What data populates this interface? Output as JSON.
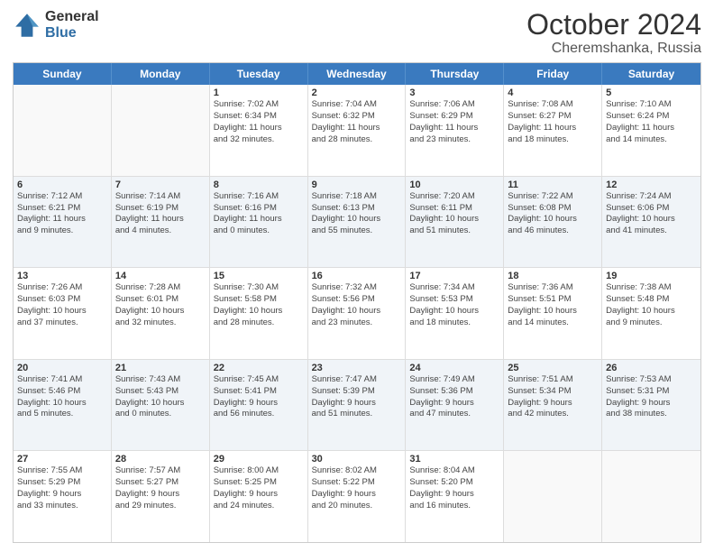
{
  "header": {
    "logo_general": "General",
    "logo_blue": "Blue",
    "month": "October 2024",
    "location": "Cheremshanka, Russia"
  },
  "weekdays": [
    "Sunday",
    "Monday",
    "Tuesday",
    "Wednesday",
    "Thursday",
    "Friday",
    "Saturday"
  ],
  "rows": [
    [
      {
        "day": "",
        "info": ""
      },
      {
        "day": "",
        "info": ""
      },
      {
        "day": "1",
        "info": "Sunrise: 7:02 AM\nSunset: 6:34 PM\nDaylight: 11 hours\nand 32 minutes."
      },
      {
        "day": "2",
        "info": "Sunrise: 7:04 AM\nSunset: 6:32 PM\nDaylight: 11 hours\nand 28 minutes."
      },
      {
        "day": "3",
        "info": "Sunrise: 7:06 AM\nSunset: 6:29 PM\nDaylight: 11 hours\nand 23 minutes."
      },
      {
        "day": "4",
        "info": "Sunrise: 7:08 AM\nSunset: 6:27 PM\nDaylight: 11 hours\nand 18 minutes."
      },
      {
        "day": "5",
        "info": "Sunrise: 7:10 AM\nSunset: 6:24 PM\nDaylight: 11 hours\nand 14 minutes."
      }
    ],
    [
      {
        "day": "6",
        "info": "Sunrise: 7:12 AM\nSunset: 6:21 PM\nDaylight: 11 hours\nand 9 minutes."
      },
      {
        "day": "7",
        "info": "Sunrise: 7:14 AM\nSunset: 6:19 PM\nDaylight: 11 hours\nand 4 minutes."
      },
      {
        "day": "8",
        "info": "Sunrise: 7:16 AM\nSunset: 6:16 PM\nDaylight: 11 hours\nand 0 minutes."
      },
      {
        "day": "9",
        "info": "Sunrise: 7:18 AM\nSunset: 6:13 PM\nDaylight: 10 hours\nand 55 minutes."
      },
      {
        "day": "10",
        "info": "Sunrise: 7:20 AM\nSunset: 6:11 PM\nDaylight: 10 hours\nand 51 minutes."
      },
      {
        "day": "11",
        "info": "Sunrise: 7:22 AM\nSunset: 6:08 PM\nDaylight: 10 hours\nand 46 minutes."
      },
      {
        "day": "12",
        "info": "Sunrise: 7:24 AM\nSunset: 6:06 PM\nDaylight: 10 hours\nand 41 minutes."
      }
    ],
    [
      {
        "day": "13",
        "info": "Sunrise: 7:26 AM\nSunset: 6:03 PM\nDaylight: 10 hours\nand 37 minutes."
      },
      {
        "day": "14",
        "info": "Sunrise: 7:28 AM\nSunset: 6:01 PM\nDaylight: 10 hours\nand 32 minutes."
      },
      {
        "day": "15",
        "info": "Sunrise: 7:30 AM\nSunset: 5:58 PM\nDaylight: 10 hours\nand 28 minutes."
      },
      {
        "day": "16",
        "info": "Sunrise: 7:32 AM\nSunset: 5:56 PM\nDaylight: 10 hours\nand 23 minutes."
      },
      {
        "day": "17",
        "info": "Sunrise: 7:34 AM\nSunset: 5:53 PM\nDaylight: 10 hours\nand 18 minutes."
      },
      {
        "day": "18",
        "info": "Sunrise: 7:36 AM\nSunset: 5:51 PM\nDaylight: 10 hours\nand 14 minutes."
      },
      {
        "day": "19",
        "info": "Sunrise: 7:38 AM\nSunset: 5:48 PM\nDaylight: 10 hours\nand 9 minutes."
      }
    ],
    [
      {
        "day": "20",
        "info": "Sunrise: 7:41 AM\nSunset: 5:46 PM\nDaylight: 10 hours\nand 5 minutes."
      },
      {
        "day": "21",
        "info": "Sunrise: 7:43 AM\nSunset: 5:43 PM\nDaylight: 10 hours\nand 0 minutes."
      },
      {
        "day": "22",
        "info": "Sunrise: 7:45 AM\nSunset: 5:41 PM\nDaylight: 9 hours\nand 56 minutes."
      },
      {
        "day": "23",
        "info": "Sunrise: 7:47 AM\nSunset: 5:39 PM\nDaylight: 9 hours\nand 51 minutes."
      },
      {
        "day": "24",
        "info": "Sunrise: 7:49 AM\nSunset: 5:36 PM\nDaylight: 9 hours\nand 47 minutes."
      },
      {
        "day": "25",
        "info": "Sunrise: 7:51 AM\nSunset: 5:34 PM\nDaylight: 9 hours\nand 42 minutes."
      },
      {
        "day": "26",
        "info": "Sunrise: 7:53 AM\nSunset: 5:31 PM\nDaylight: 9 hours\nand 38 minutes."
      }
    ],
    [
      {
        "day": "27",
        "info": "Sunrise: 7:55 AM\nSunset: 5:29 PM\nDaylight: 9 hours\nand 33 minutes."
      },
      {
        "day": "28",
        "info": "Sunrise: 7:57 AM\nSunset: 5:27 PM\nDaylight: 9 hours\nand 29 minutes."
      },
      {
        "day": "29",
        "info": "Sunrise: 8:00 AM\nSunset: 5:25 PM\nDaylight: 9 hours\nand 24 minutes."
      },
      {
        "day": "30",
        "info": "Sunrise: 8:02 AM\nSunset: 5:22 PM\nDaylight: 9 hours\nand 20 minutes."
      },
      {
        "day": "31",
        "info": "Sunrise: 8:04 AM\nSunset: 5:20 PM\nDaylight: 9 hours\nand 16 minutes."
      },
      {
        "day": "",
        "info": ""
      },
      {
        "day": "",
        "info": ""
      }
    ]
  ]
}
